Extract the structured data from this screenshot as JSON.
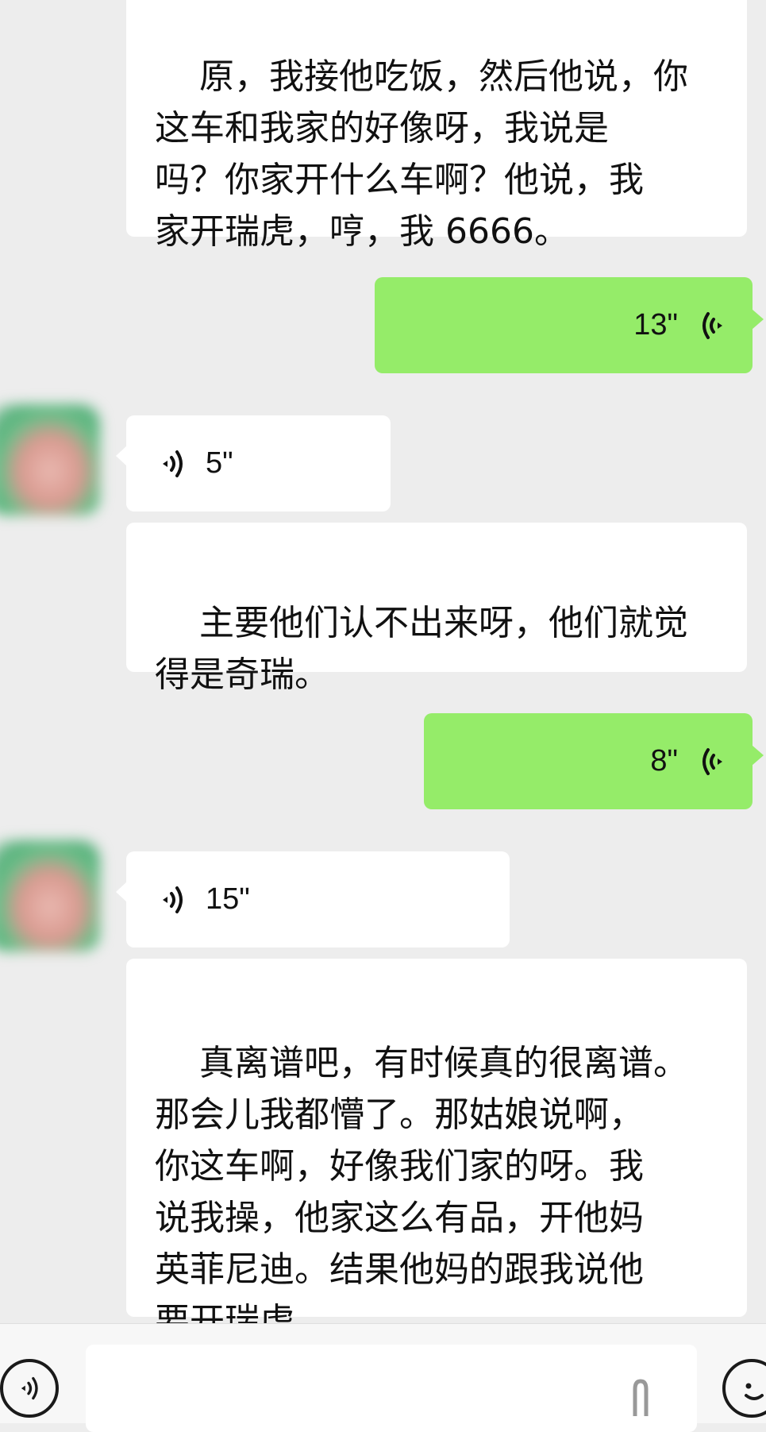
{
  "messages": [
    {
      "id": "m1",
      "from": "other",
      "type": "text",
      "text": "原，我接他吃饭，然后他说，你\n这车和我家的好像呀，我说是\n吗？你家开什么车啊？他说，我\n家开瑞虎，哼，我 6666。"
    },
    {
      "id": "m2",
      "from": "me",
      "type": "voice",
      "duration": "13\""
    },
    {
      "id": "m3",
      "from": "other",
      "type": "voice",
      "duration": "5\""
    },
    {
      "id": "m4",
      "from": "other",
      "type": "text",
      "text": "主要他们认不出来呀，他们就觉\n得是奇瑞。"
    },
    {
      "id": "m5",
      "from": "me",
      "type": "voice",
      "duration": "8\""
    },
    {
      "id": "m6",
      "from": "other",
      "type": "voice",
      "duration": "15\""
    },
    {
      "id": "m7",
      "from": "other",
      "type": "text",
      "text": "真离谱吧，有时候真的很离谱。\n那会儿我都懵了。那姑娘说啊，\n你这车啊，好像我们家的呀。我\n说我操，他家这么有品，开他妈\n英菲尼迪。结果他妈的跟我说他\n要开瑞虎。"
    }
  ],
  "input_bar": {
    "voice_toggle_icon": "voice-icon",
    "text_value": "",
    "emoji_icon": "emoji-icon"
  },
  "colors": {
    "background": "#ededed",
    "incoming_bubble": "#ffffff",
    "outgoing_bubble": "#95ec69"
  }
}
